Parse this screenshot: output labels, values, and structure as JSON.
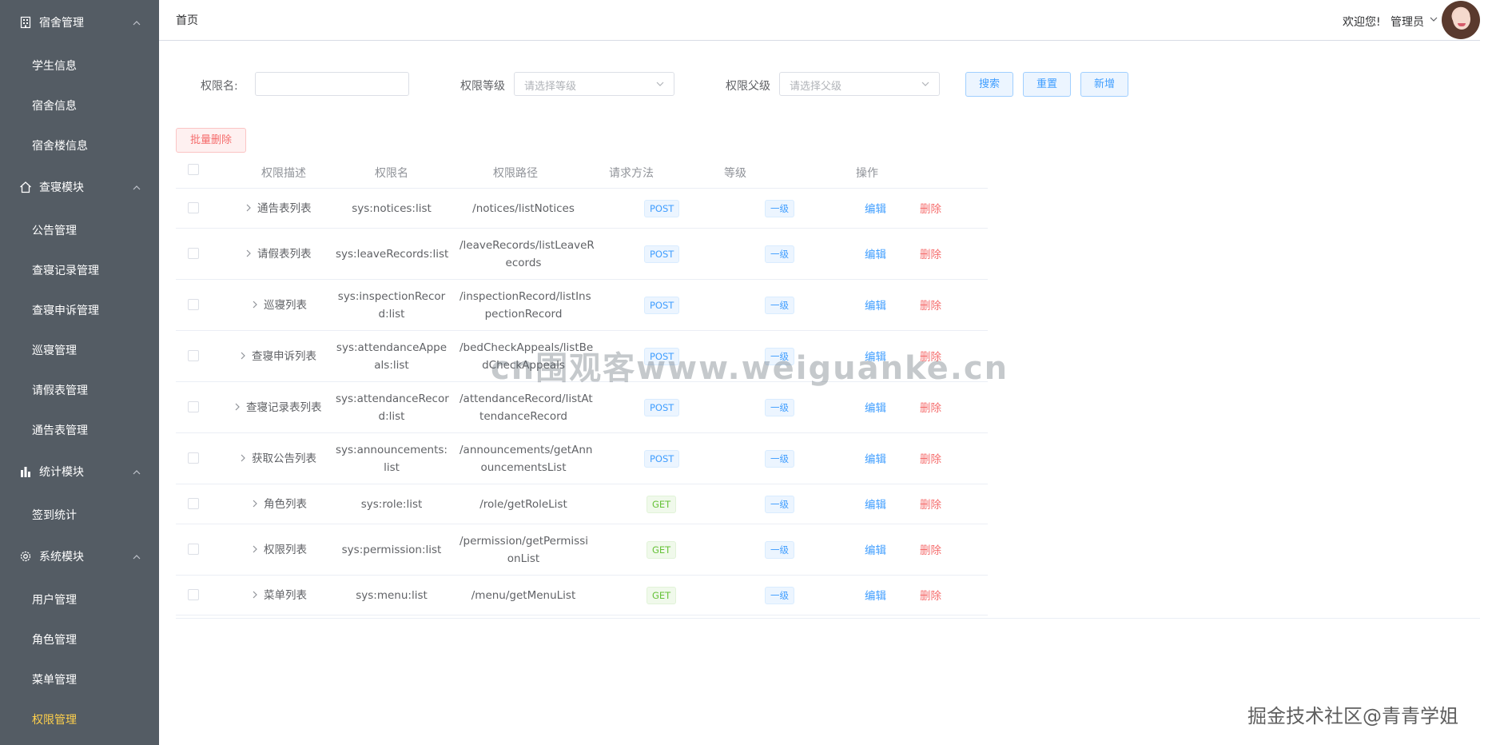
{
  "sidebar": {
    "groups": [
      {
        "label": "宿舍管理",
        "icon": "building-icon",
        "items": [
          {
            "label": "学生信息"
          },
          {
            "label": "宿舍信息"
          },
          {
            "label": "宿舍楼信息"
          }
        ]
      },
      {
        "label": "查寝模块",
        "icon": "home-icon",
        "items": [
          {
            "label": "公告管理"
          },
          {
            "label": "查寝记录管理"
          },
          {
            "label": "查寝申诉管理"
          },
          {
            "label": "巡寝管理"
          },
          {
            "label": "请假表管理"
          },
          {
            "label": "通告表管理"
          }
        ]
      },
      {
        "label": "统计模块",
        "icon": "bar-chart-icon",
        "items": [
          {
            "label": "签到统计"
          }
        ]
      },
      {
        "label": "系统模块",
        "icon": "gear-icon",
        "items": [
          {
            "label": "用户管理"
          },
          {
            "label": "角色管理"
          },
          {
            "label": "菜单管理"
          },
          {
            "label": "权限管理"
          }
        ]
      }
    ],
    "active_item": "权限管理",
    "active_color": "#ffd04b",
    "bg_color": "#545c64"
  },
  "header": {
    "breadcrumb": "首页",
    "welcome": "欢迎您!",
    "user": "管理员"
  },
  "filters": {
    "name_label": "权限名:",
    "name_value": "",
    "level_label": "权限等级",
    "level_placeholder": "请选择等级",
    "parent_label": "权限父级",
    "parent_placeholder": "请选择父级",
    "search_button": "搜索",
    "reset_button": "重置",
    "add_button": "新增"
  },
  "batch_delete_button": "批量删除",
  "table": {
    "columns": [
      "权限描述",
      "权限名",
      "权限路径",
      "请求方法",
      "等级",
      "操作"
    ],
    "edit_label": "编辑",
    "delete_label": "删除",
    "rows": [
      {
        "desc": "通告表列表",
        "name": [
          "sys:notices:list"
        ],
        "path": [
          "/notices/listNotices"
        ],
        "method": "POST",
        "level": "一级"
      },
      {
        "desc": "请假表列表",
        "name": [
          "sys:leaveRecords:list"
        ],
        "path": [
          "/leaveRecords/listLeaveR",
          "ecords"
        ],
        "method": "POST",
        "level": "一级"
      },
      {
        "desc": "巡寝列表",
        "name": [
          "sys:inspectionRecor",
          "d:list"
        ],
        "path": [
          "/inspectionRecord/listIns",
          "pectionRecord"
        ],
        "method": "POST",
        "level": "一级"
      },
      {
        "desc": "查寝申诉列表",
        "name": [
          "sys:attendanceAppe",
          "als:list"
        ],
        "path": [
          "/bedCheckAppeals/listBe",
          "dCheckAppeals"
        ],
        "method": "POST",
        "level": "一级"
      },
      {
        "desc": "查寝记录表列表",
        "name": [
          "sys:attendanceRecor",
          "d:list"
        ],
        "path": [
          "/attendanceRecord/listAt",
          "tendanceRecord"
        ],
        "method": "POST",
        "level": "一级"
      },
      {
        "desc": "获取公告列表",
        "name": [
          "sys:announcements:",
          "list"
        ],
        "path": [
          "/announcements/getAnn",
          "ouncementsList"
        ],
        "method": "POST",
        "level": "一级"
      },
      {
        "desc": "角色列表",
        "name": [
          "sys:role:list"
        ],
        "path": [
          "/role/getRoleList"
        ],
        "method": "GET",
        "level": "一级"
      },
      {
        "desc": "权限列表",
        "name": [
          "sys:permission:list"
        ],
        "path": [
          "/permission/getPermissi",
          "onList"
        ],
        "method": "GET",
        "level": "一级"
      },
      {
        "desc": "菜单列表",
        "name": [
          "sys:menu:list"
        ],
        "path": [
          "/menu/getMenuList"
        ],
        "method": "GET",
        "level": "一级"
      }
    ]
  },
  "watermark_center": "cn围观客www.weiguanke.cn",
  "watermark_corner": "掘金技术社区@青青学姐"
}
